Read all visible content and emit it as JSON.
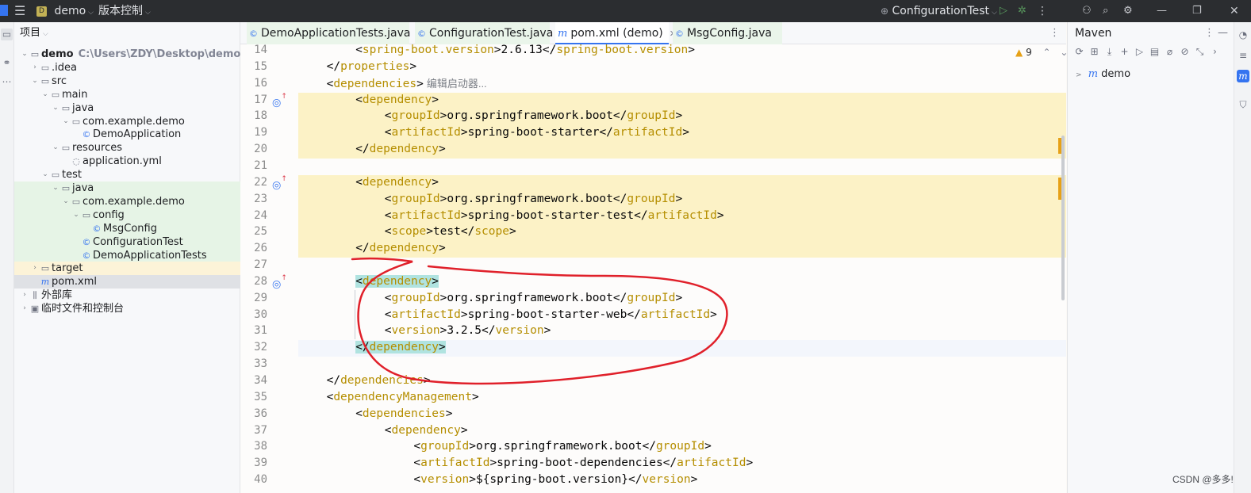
{
  "titlebar": {
    "project_badge": "D",
    "project_name": "demo",
    "vcs_label": "版本控制",
    "run_config": "ConfigurationTest",
    "colors": {
      "bg": "#2b2d30",
      "badge": "#c3b255",
      "run": "#57965c"
    }
  },
  "project_panel": {
    "title": "项目",
    "tree": [
      {
        "label": "demo",
        "path": "C:\\Users\\ZDY\\Desktop\\demo",
        "icon": "folder-icon",
        "indent": 0,
        "arrow": "v",
        "bold": true
      },
      {
        "label": ".idea",
        "icon": "folder-icon",
        "indent": 1,
        "arrow": ">"
      },
      {
        "label": "src",
        "icon": "folder-icon",
        "indent": 1,
        "arrow": "v"
      },
      {
        "label": "main",
        "icon": "folder-icon",
        "indent": 2,
        "arrow": "v"
      },
      {
        "label": "java",
        "icon": "folder-icon",
        "indent": 3,
        "arrow": "v"
      },
      {
        "label": "com.example.demo",
        "icon": "package-icon",
        "indent": 4,
        "arrow": "v"
      },
      {
        "label": "DemoApplication",
        "icon": "class-icon",
        "indent": 5,
        "arrow": ""
      },
      {
        "label": "resources",
        "icon": "folder-icon",
        "indent": 3,
        "arrow": "v"
      },
      {
        "label": "application.yml",
        "icon": "yml-icon",
        "indent": 4,
        "arrow": ""
      },
      {
        "label": "test",
        "icon": "folder-icon",
        "indent": 2,
        "arrow": "v"
      },
      {
        "label": "java",
        "icon": "folder-icon",
        "indent": 3,
        "arrow": "v",
        "hl": "green"
      },
      {
        "label": "com.example.demo",
        "icon": "package-icon",
        "indent": 4,
        "arrow": "v",
        "hl": "green"
      },
      {
        "label": "config",
        "icon": "package-icon",
        "indent": 5,
        "arrow": "v",
        "hl": "green"
      },
      {
        "label": "MsgConfig",
        "icon": "class-icon",
        "indent": 6,
        "arrow": "",
        "hl": "green"
      },
      {
        "label": "ConfigurationTest",
        "icon": "class-icon",
        "indent": 5,
        "arrow": "",
        "hl": "green"
      },
      {
        "label": "DemoApplicationTests",
        "icon": "class-icon",
        "indent": 5,
        "arrow": "",
        "hl": "green"
      },
      {
        "label": "target",
        "icon": "folder-icon",
        "indent": 1,
        "arrow": ">",
        "hl": "yellow"
      },
      {
        "label": "pom.xml",
        "icon": "maven-icon",
        "indent": 1,
        "arrow": "",
        "hl": "selected"
      },
      {
        "label": "外部库",
        "icon": "library-icon",
        "indent": 0,
        "arrow": ">"
      },
      {
        "label": "临时文件和控制台",
        "icon": "scratch-icon",
        "indent": 0,
        "arrow": ">"
      }
    ]
  },
  "tabs": [
    {
      "label": "DemoApplicationTests.java",
      "icon": "class-icon",
      "active": false,
      "green": true
    },
    {
      "label": "ConfigurationTest.java",
      "icon": "class-icon",
      "active": false,
      "green": true
    },
    {
      "label": "pom.xml (demo)",
      "icon": "maven-icon",
      "active": true,
      "green": false,
      "closable": true
    },
    {
      "label": "MsgConfig.java",
      "icon": "class-icon",
      "active": false,
      "green": true
    }
  ],
  "editor": {
    "warnings": "9",
    "hint_text": "编辑启动器...",
    "lines": [
      {
        "n": "14",
        "indent": 2,
        "open": "spring-boot.version",
        "text": "2.6.13",
        "close": "spring-boot.version"
      },
      {
        "n": "15",
        "indent": 1,
        "close_only": "properties"
      },
      {
        "n": "16",
        "indent": 1,
        "open_only": "dependencies",
        "hint": true
      },
      {
        "n": "17",
        "indent": 2,
        "open_only": "dependency",
        "gutter": true
      },
      {
        "n": "18",
        "indent": 3,
        "open": "groupId",
        "text": "org.springframework.boot",
        "close": "groupId"
      },
      {
        "n": "19",
        "indent": 3,
        "open": "artifactId",
        "text": "spring-boot-starter",
        "close": "artifactId"
      },
      {
        "n": "20",
        "indent": 2,
        "close_only": "dependency"
      },
      {
        "n": "21",
        "indent": 0
      },
      {
        "n": "22",
        "indent": 2,
        "open_only": "dependency",
        "gutter": true
      },
      {
        "n": "23",
        "indent": 3,
        "open": "groupId",
        "text": "org.springframework.boot",
        "close": "groupId"
      },
      {
        "n": "24",
        "indent": 3,
        "open": "artifactId",
        "text": "spring-boot-starter-test",
        "close": "artifactId"
      },
      {
        "n": "25",
        "indent": 3,
        "open": "scope",
        "text": "test",
        "close": "scope"
      },
      {
        "n": "26",
        "indent": 2,
        "close_only": "dependency"
      },
      {
        "n": "27",
        "indent": 0
      },
      {
        "n": "28",
        "indent": 2,
        "open_only": "dependency",
        "gutter": true,
        "match": true
      },
      {
        "n": "29",
        "indent": 3,
        "open": "groupId",
        "text": "org.springframework.boot",
        "close": "groupId"
      },
      {
        "n": "30",
        "indent": 3,
        "open": "artifactId",
        "text": "spring-boot-starter-web",
        "close": "artifactId"
      },
      {
        "n": "31",
        "indent": 3,
        "open": "version",
        "text": "3.2.5",
        "close": "version"
      },
      {
        "n": "32",
        "indent": 2,
        "close_only": "dependency",
        "match": true,
        "current": true
      },
      {
        "n": "33",
        "indent": 0
      },
      {
        "n": "34",
        "indent": 1,
        "close_only": "dependencies"
      },
      {
        "n": "35",
        "indent": 1,
        "open_only": "dependencyManagement"
      },
      {
        "n": "36",
        "indent": 2,
        "open_only": "dependencies"
      },
      {
        "n": "37",
        "indent": 3,
        "open_only": "dependency"
      },
      {
        "n": "38",
        "indent": 4,
        "open": "groupId",
        "text": "org.springframework.boot",
        "close": "groupId"
      },
      {
        "n": "39",
        "indent": 4,
        "open": "artifactId",
        "text": "spring-boot-dependencies",
        "close": "artifactId"
      },
      {
        "n": "40",
        "indent": 4,
        "open": "version",
        "text": "${spring-boot.version}",
        "close": "version"
      }
    ],
    "colors": {
      "tag": "#b58e00",
      "yellow_hl": "#fcf2c6",
      "match_hl": "#b0e3e0",
      "current_line": "#f3f6fc"
    }
  },
  "maven": {
    "title": "Maven",
    "project": "demo"
  },
  "watermark": "CSDN @多多!",
  "annotation_color": "#e0202a"
}
